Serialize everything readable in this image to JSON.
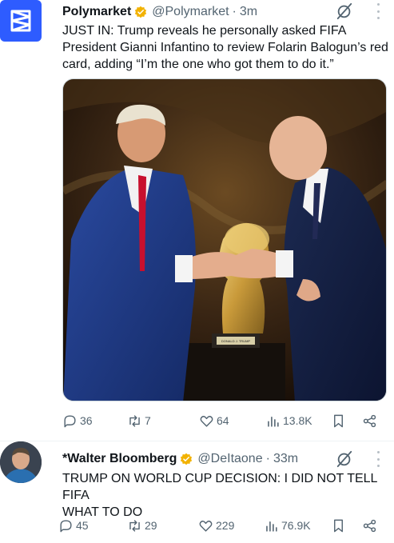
{
  "tweets": [
    {
      "author": "Polymarket",
      "handle": "@Polymarket",
      "time": "3m",
      "text_lines": [
        "JUST IN: Trump reveals he personally asked FIFA",
        "President Gianni Infantino to review Folarin Balogun’s red",
        "card, adding “I’m the one who got them to do it.”"
      ],
      "trophy_plaque": "DONALD J. TRUMP",
      "stats": {
        "replies": "36",
        "reposts": "7",
        "likes": "64",
        "views": "13.8K"
      }
    },
    {
      "author": "*Walter Bloomberg",
      "handle": "@DeItaone",
      "time": "33m",
      "text_lines": [
        "TRUMP ON WORLD CUP DECISION: I DID NOT TELL FIFA",
        "WHAT TO DO"
      ],
      "stats": {
        "replies": "45",
        "reposts": "29",
        "likes": "229",
        "views": "76.9K"
      }
    }
  ],
  "colors": {
    "verified_badge": "#f2b200",
    "polymarket_brand": "#2e5cff",
    "muted_text": "#536471"
  },
  "icons": [
    "polymarket-logo-icon",
    "verified-badge-icon",
    "grok-icon",
    "more-icon",
    "reply-icon",
    "repost-icon",
    "like-icon",
    "views-icon",
    "bookmark-icon",
    "share-icon"
  ]
}
